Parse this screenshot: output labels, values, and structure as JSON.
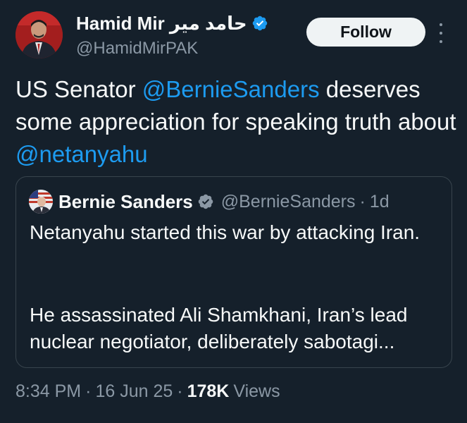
{
  "author": {
    "display_name": "Hamid Mir حامد میر",
    "handle": "@HamidMirPAK",
    "verified": true,
    "avatar_icon": "avatar-photo-icon"
  },
  "actions": {
    "follow_label": "Follow",
    "more_icon": "more-options-icon"
  },
  "tweet": {
    "text_parts": [
      {
        "text": "US Senator ",
        "type": "text"
      },
      {
        "text": "@BernieSanders",
        "type": "mention"
      },
      {
        "text": " deserves some appreciation for speaking truth about ",
        "type": "text"
      },
      {
        "text": "@netanyahu",
        "type": "mention"
      }
    ]
  },
  "quote": {
    "display_name": "Bernie Sanders",
    "handle": "@BernieSanders",
    "separator": "·",
    "time": "1d",
    "paragraph1": "Netanyahu started this war by attacking Iran.",
    "paragraph2": "He assassinated Ali Shamkhani, Iran’s lead nuclear negotiator, deliberately sabotagi..."
  },
  "meta": {
    "time": "8:34 PM",
    "separator": "·",
    "date": "16 Jun 25",
    "views_count": "178K",
    "views_label": "Views"
  },
  "colors": {
    "background": "#15202b",
    "text": "#f7f9f9",
    "secondary": "#8b98a5",
    "accent": "#1d9bf0",
    "border": "#38444d"
  }
}
